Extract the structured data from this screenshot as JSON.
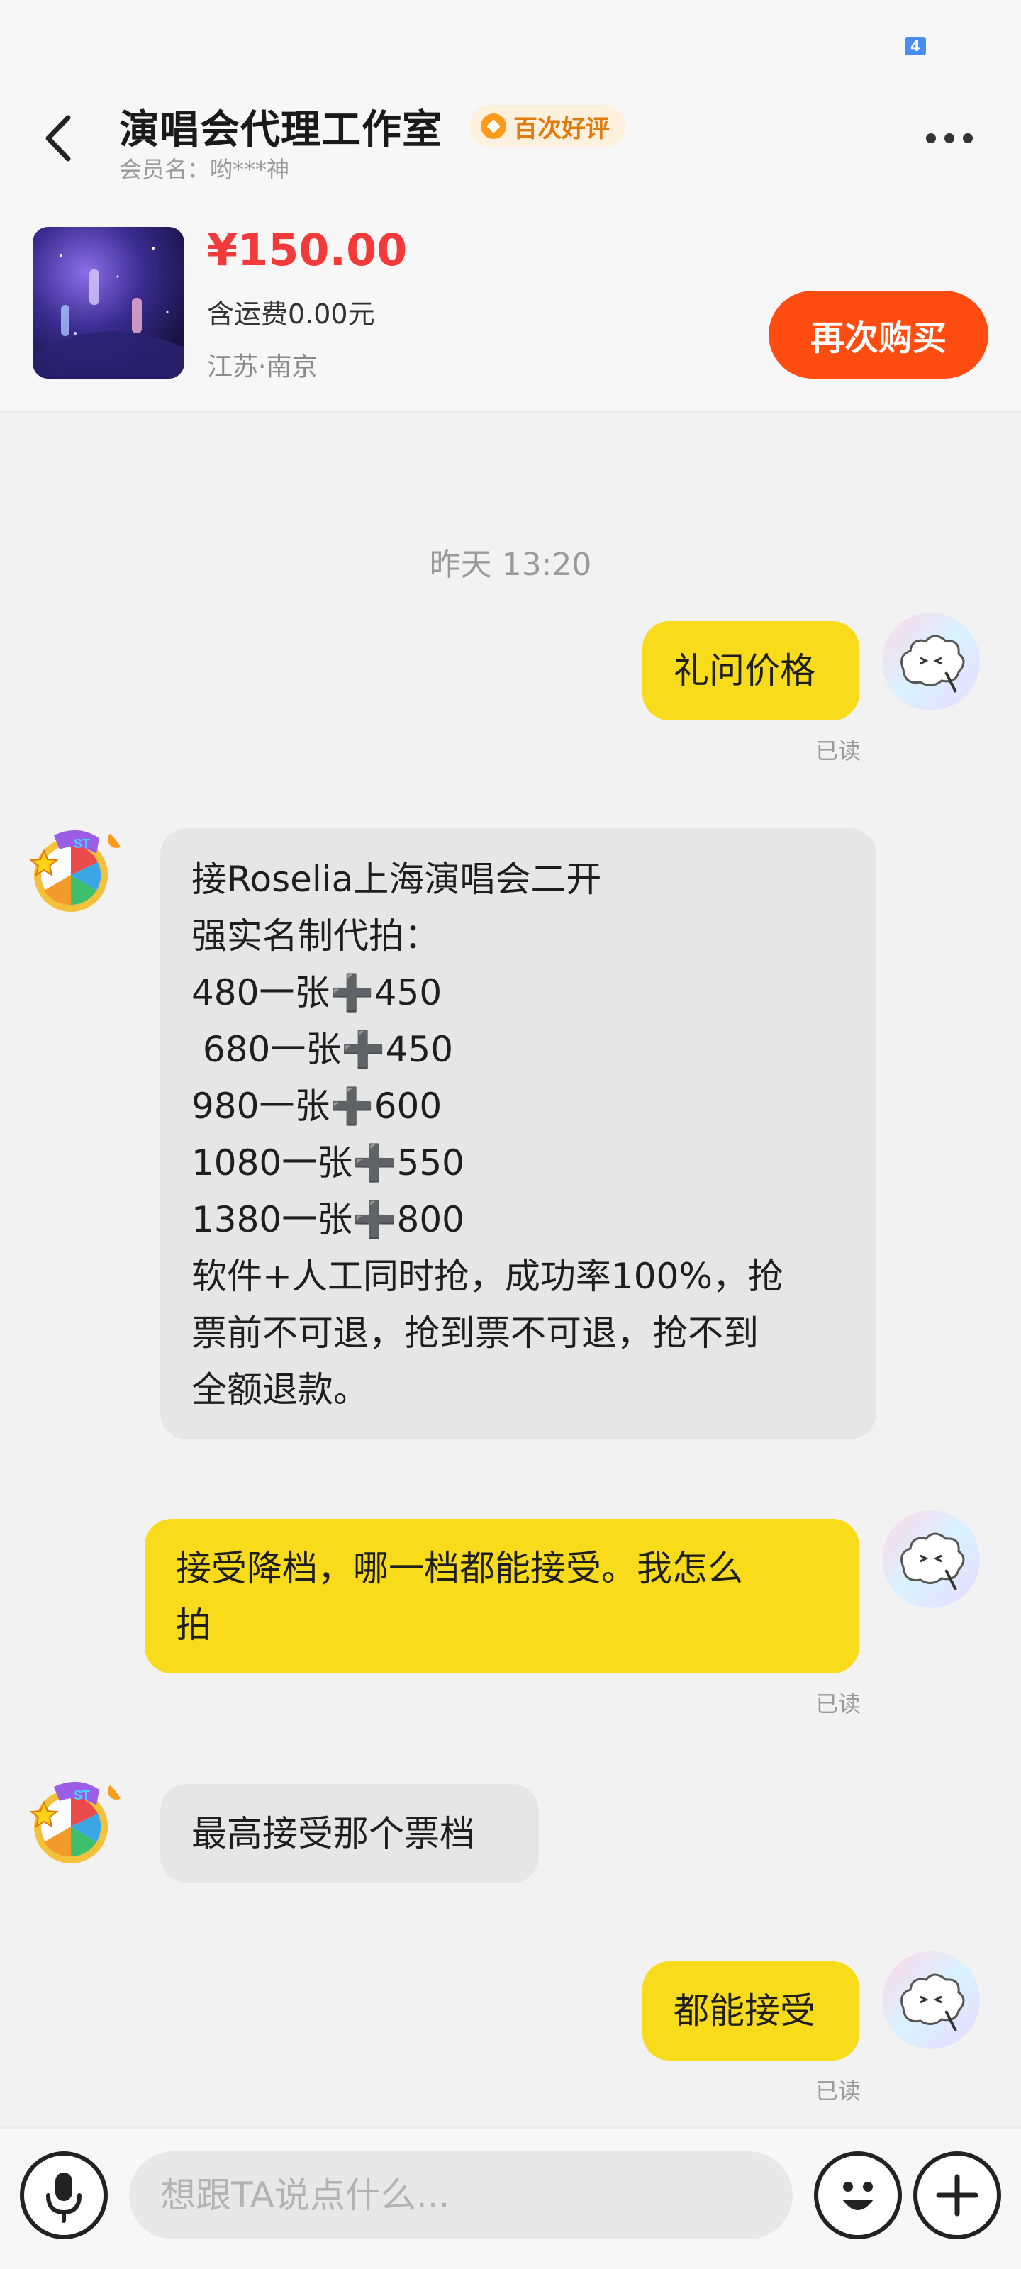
{
  "header": {
    "status_icon_text": "4",
    "shop_name": "演唱会代理工作室",
    "badge_text": "百次好评",
    "member_name": "会员名：哟***神"
  },
  "product": {
    "price": "¥150.00",
    "shipping": "含运费0.00元",
    "location": "江苏·南京",
    "buy_again_label": "再次购买"
  },
  "chat": {
    "timestamp": "昨天 13:20",
    "read_label": "已读",
    "messages": [
      {
        "from": "me",
        "lines": [
          "礼问价格"
        ]
      },
      {
        "from": "seller",
        "lines": [
          "接Roselia上海演唱会二开",
          "强实名制代拍：",
          "480一张➕450",
          " 680一张➕450",
          "980一张➕600",
          "1080一张➕550",
          "1380一张➕800",
          "软件+人工同时抢，成功率100%，抢",
          "票前不可退，抢到票不可退，抢不到",
          "全额退款。"
        ]
      },
      {
        "from": "me",
        "lines": [
          "接受降档，哪一档都能接受。我怎么",
          "拍"
        ]
      },
      {
        "from": "seller",
        "lines": [
          "最高接受那个票档"
        ]
      },
      {
        "from": "me",
        "lines": [
          "都能接受"
        ]
      }
    ]
  },
  "input_bar": {
    "placeholder": "想跟TA说点什么..."
  },
  "colors": {
    "my_bubble": "#f8db1a",
    "their_bubble": "#e6e6e6",
    "buy_button": "#ff4d12",
    "price": "#f23a3a"
  }
}
